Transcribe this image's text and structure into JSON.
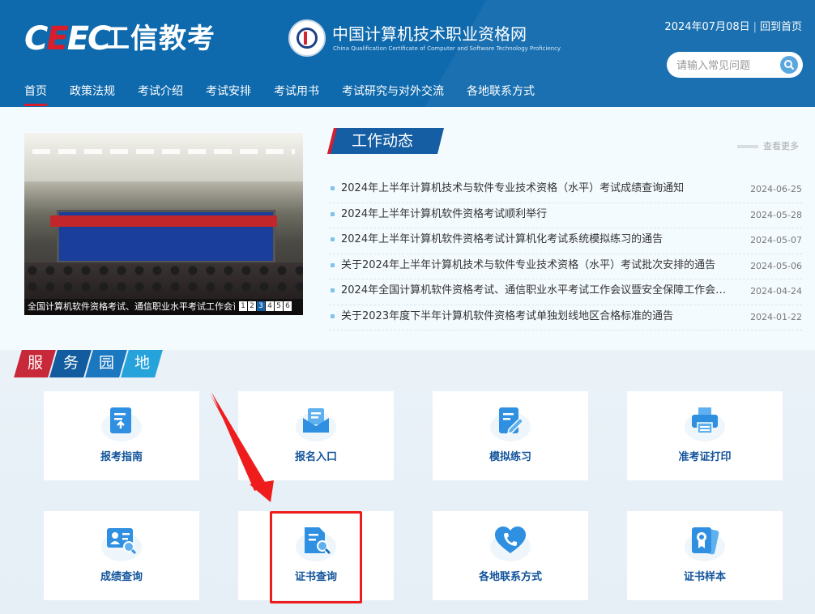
{
  "header": {
    "logo_ceec": "CEEC",
    "logo_title": "工信教考",
    "site_title_cn": "中国计算机技术职业资格网",
    "site_title_en": "China Qualification Certificate of Computer and Software Technology Proficiency",
    "date": "2024年07月08日",
    "separator": "|",
    "home_link": "回到首页",
    "search_placeholder": "请输入常见问题",
    "nav": [
      "首页",
      "政策法规",
      "考试介绍",
      "考试安排",
      "考试用书",
      "考试研究与对外交流",
      "各地联系方式"
    ]
  },
  "slider": {
    "caption": "全国计算机软件资格考试、通信职业水平考试工作会议暨安全",
    "pages": [
      "1",
      "2",
      "3",
      "4",
      "5",
      "6"
    ],
    "active_page": "3"
  },
  "news": {
    "title": "工作动态",
    "more": "查看更多",
    "items": [
      {
        "text": "2024年上半年计算机技术与软件专业技术资格（水平）考试成绩查询通知",
        "date": "2024-06-25"
      },
      {
        "text": "2024年上半年计算机软件资格考试顺利举行",
        "date": "2024-05-28"
      },
      {
        "text": "2024年上半年计算机软件资格考试计算机化考试系统模拟练习的通告",
        "date": "2024-05-07"
      },
      {
        "text": "关于2024年上半年计算机技术与软件专业技术资格（水平）考试批次安排的通告",
        "date": "2024-05-06"
      },
      {
        "text": "2024年全国计算机软件资格考试、通信职业水平考试工作会议暨安全保障工作会…",
        "date": "2024-04-24"
      },
      {
        "text": "关于2023年度下半年计算机软件资格考试单独划线地区合格标准的通告",
        "date": "2024-01-22"
      }
    ]
  },
  "services": {
    "label_chars": [
      "服",
      "务",
      "园",
      "地"
    ],
    "label_colors": [
      "#c7283a",
      "#125b9f",
      "#1b77c0",
      "#27a3dc"
    ],
    "cards": [
      {
        "label": "报考指南",
        "icon": "guide-doc-icon"
      },
      {
        "label": "报名入口",
        "icon": "register-mail-icon"
      },
      {
        "label": "模拟练习",
        "icon": "practice-edit-icon"
      },
      {
        "label": "准考证打印",
        "icon": "printer-icon"
      },
      {
        "label": "成绩查询",
        "icon": "score-search-icon"
      },
      {
        "label": "证书查询",
        "icon": "certificate-search-icon"
      },
      {
        "label": "各地联系方式",
        "icon": "phone-heart-icon"
      },
      {
        "label": "证书样本",
        "icon": "certificate-sample-icon"
      }
    ]
  },
  "annotation": {
    "highlight_color": "#ee1c1c",
    "highlighted_card": "证书查询"
  }
}
